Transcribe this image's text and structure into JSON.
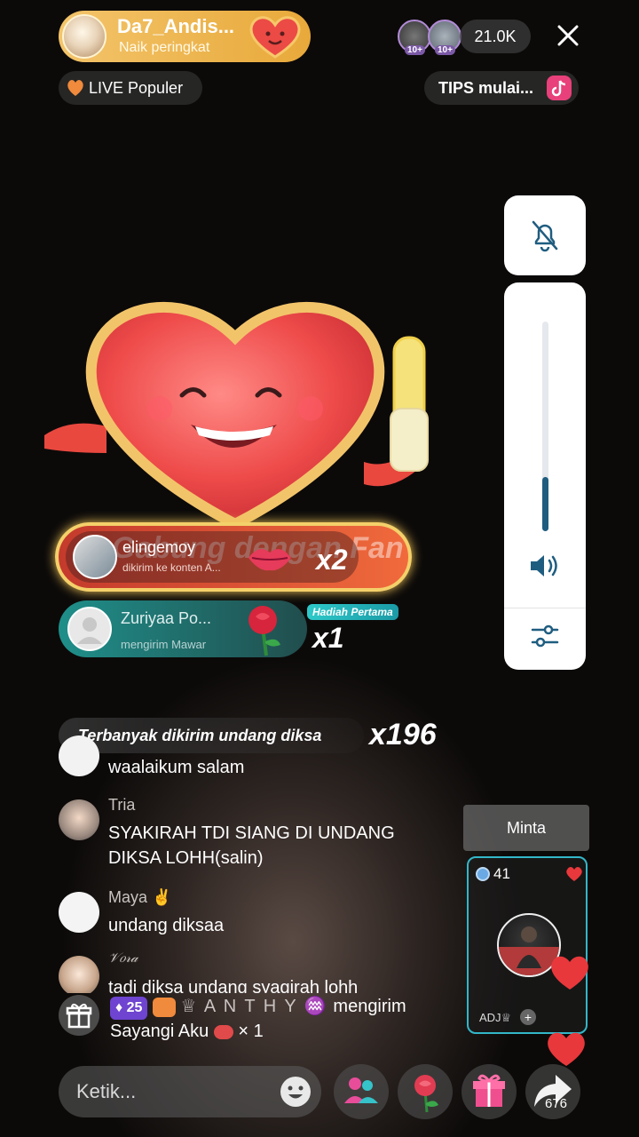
{
  "host": {
    "name": "Da7_Andis...",
    "subtitle": "Naik peringkat"
  },
  "viewers": {
    "badge_1": "10+",
    "badge_2": "10+",
    "count": "21.0K"
  },
  "tags": {
    "live_popular": "LIVE Populer",
    "tips": "TIPS mulai..."
  },
  "controls": {
    "volume_level": 0.26
  },
  "gifts": {
    "combo1": {
      "user": "elingemoy",
      "subtitle": "dikirim ke konten A...",
      "background_text": "Gabung dengan Fan Club saya",
      "count": "x2"
    },
    "combo2": {
      "user": "Zuriyaa Po...",
      "subtitle": "mengirim Mawar",
      "badge": "Hadiah Pertama",
      "count": "x1"
    },
    "most_sent": {
      "prefix": "Terbanyak dikirim",
      "name": "undang diksa",
      "count": "x196"
    }
  },
  "chat": [
    {
      "user": "",
      "text": "waalaikum salam"
    },
    {
      "user": "Tria",
      "text": "SYAKIRAH TDI SIANG DI UNDANG DIKSA LOHH(salin)"
    },
    {
      "user": "Maya ✌️",
      "text": "undang diksaa"
    },
    {
      "user": "𝒱𝑜𝓇𝒶",
      "text": "tadi diksa undang syagirah lohh"
    }
  ],
  "gift_message": {
    "level": "25",
    "sender": "♕ A N T H Y ♒",
    "action": "mengirim",
    "gift": "Sayangi Aku",
    "count": "× 1"
  },
  "request": {
    "button": "Minta",
    "coins": "41",
    "tag": "ADJ♕"
  },
  "bottom": {
    "placeholder": "Ketik...",
    "share_count": "676"
  },
  "colors": {
    "accent_gold": "#f3c46a",
    "combo_teal": "#1f8f8a",
    "heart_red": "#e8383b",
    "guest_border": "#33b7c9"
  },
  "icons": [
    "close-icon",
    "heart-icon",
    "tiktok-icon",
    "bell-off-icon",
    "volume-icon",
    "sliders-icon",
    "gift-icon",
    "emoji-icon",
    "people-icon",
    "rose-icon",
    "present-icon",
    "share-icon"
  ]
}
